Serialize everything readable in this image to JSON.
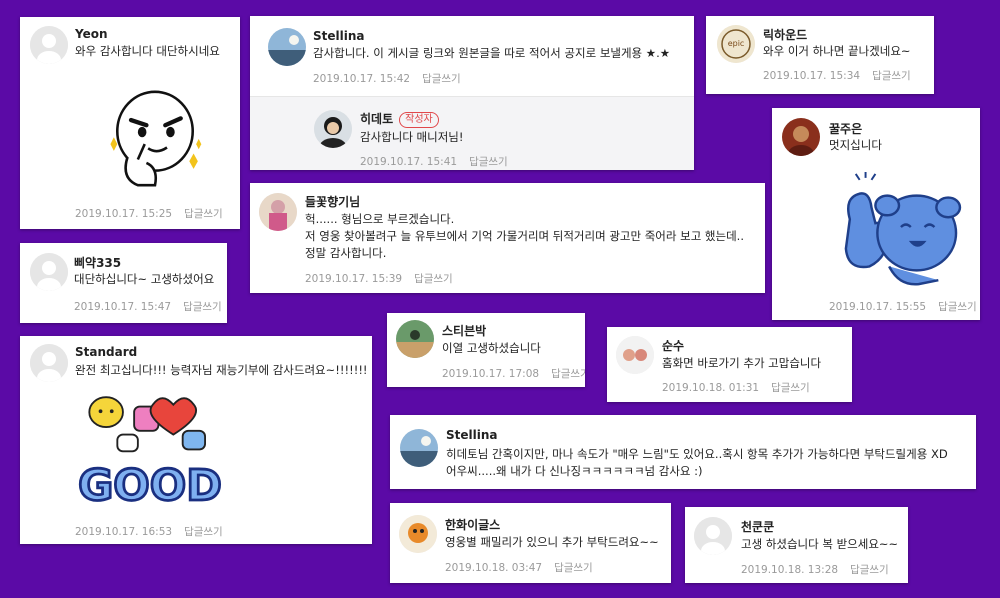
{
  "reply_label": "답글쓰기",
  "author_badge": "작성자",
  "comments": {
    "yeon": {
      "name": "Yeon",
      "text": "와우 감사합니다 대단하시네요",
      "date": "2019.10.17. 15:25"
    },
    "stellina1": {
      "name": "Stellina",
      "text": "감사합니다. 이 게시글 링크와 원본글을 따로 적어서 공지로 보낼게용 ★.★",
      "date": "2019.10.17. 15:42"
    },
    "hideto": {
      "name": "히데토",
      "text": "감사합니다 매니저님!",
      "date": "2019.10.17. 15:41"
    },
    "richard": {
      "name": "릭하운드",
      "text": "와우 이거 하나면 끝나겠네요~",
      "date": "2019.10.17. 15:34"
    },
    "kkul": {
      "name": "꿀주은",
      "text": "멋지십니다",
      "date": "2019.10.17. 15:55"
    },
    "deulkkot": {
      "name": "들꽃향기님",
      "lines": [
        "헉...... 형님으로 부르겠습니다.",
        "저 영웅 찾아볼려구 늘 유투브에서 기억 가물거리며 뒤적거리며 광고만 죽어라 보고 했는데..",
        "정말 감사합니다."
      ],
      "date": "2019.10.17. 15:39"
    },
    "ppiyak": {
      "name": "삐약335",
      "text": "대단하십니다~ 고생하셨어요",
      "date": "2019.10.17. 15:47"
    },
    "standard": {
      "name": "Standard",
      "text": "완전 최고십니다!!! 능력자님 재능기부에 감사드려요~!!!!!!!",
      "date": "2019.10.17. 16:53"
    },
    "steven": {
      "name": "스티븐박",
      "text": "이열 고생하셨습니다",
      "date": "2019.10.17. 17:08"
    },
    "sunsu": {
      "name": "순수",
      "text": "홈화면 바로가기 추가 고맙습니다",
      "date": "2019.10.18. 01:31"
    },
    "stellina2": {
      "name": "Stellina",
      "lines": [
        "히데토님 간혹이지만, 마나 속도가 \"매우 느림\"도 있어요..혹시 항목 추가가 가능하다면 부탁드릴게용 XD",
        "어우씨.....왜 내가 다 신나징ㅋㅋㅋㅋㅋㅋ넘 감사요 :)"
      ],
      "date": ""
    },
    "hanwha": {
      "name": "한화이글스",
      "text": "영웅별 패밀리가 있으니 추가 부탁드려요~~",
      "date": "2019.10.18. 03:47"
    },
    "cheonkun": {
      "name": "천쿤쿤",
      "text": "고생 하셨습니다 복 받으세요~~",
      "date": "2019.10.18. 13:28"
    }
  },
  "stickers": {
    "good_text": "GOOD"
  },
  "colors": {
    "background": "#5b0aa6",
    "author_badge": "#e0484b",
    "meta_text": "#9a9a9a"
  }
}
